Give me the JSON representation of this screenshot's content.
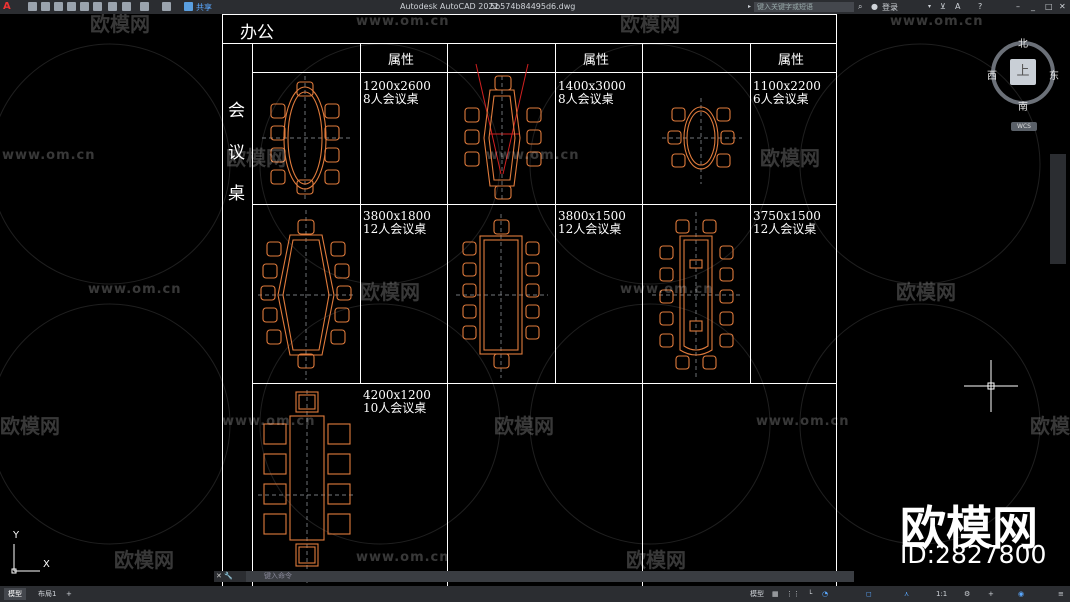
{
  "app": {
    "title": "Autodesk AutoCAD 2022",
    "filename": "5b574b84495d6.dwg",
    "logo": "A",
    "share_label": "共享",
    "search_placeholder": "键入关键字或短语",
    "login_label": "登录"
  },
  "table": {
    "title": "办公",
    "header_label": "属性",
    "category": [
      "会",
      "议",
      "桌"
    ],
    "items": [
      {
        "size": "1200x2600",
        "desc": "8人会议桌"
      },
      {
        "size": "1400x3000",
        "desc": "8人会议桌"
      },
      {
        "size": "1100x2200",
        "desc": "6人会议桌"
      },
      {
        "size": "3800x1800",
        "desc": "12人会议桌"
      },
      {
        "size": "3800x1500",
        "desc": "12人会议桌"
      },
      {
        "size": "3750x1500",
        "desc": "12人会议桌"
      },
      {
        "size": "4200x1200",
        "desc": "10人会议桌"
      }
    ]
  },
  "viewcube": {
    "north": "北",
    "south": "南",
    "west": "西",
    "east": "东",
    "top": "上",
    "wcs": "WCS"
  },
  "ucs": {
    "x": "X",
    "y": "Y"
  },
  "command": {
    "placeholder": "键入命令"
  },
  "status": {
    "model_tab": "模型",
    "layout_tab": "布局1",
    "add_tab": "+",
    "model_label": "模型",
    "scale": "1:1"
  },
  "watermark": {
    "site": "www.om.cn",
    "brand": "欧模网",
    "id_label": "ID:2827800"
  },
  "colors": {
    "grid": "#ffffff",
    "furniture": "#e07b3c",
    "dash": "#9aa0a6",
    "red": "#d12020"
  }
}
